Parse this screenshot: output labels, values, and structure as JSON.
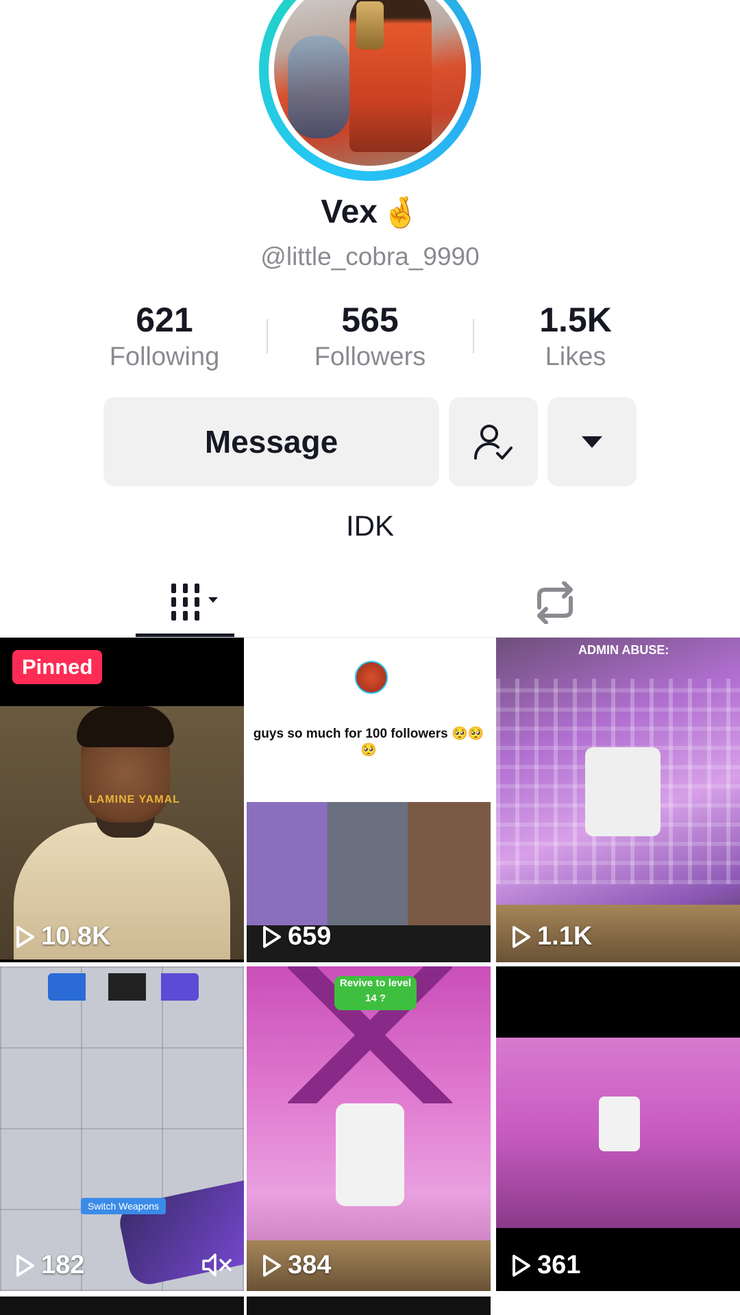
{
  "profile": {
    "display_name": "Vex",
    "name_emoji": "🤞",
    "handle": "@little_cobra_9990",
    "bio": "IDK"
  },
  "stats": {
    "following": {
      "value": "621",
      "label": "Following"
    },
    "followers": {
      "value": "565",
      "label": "Followers"
    },
    "likes": {
      "value": "1.5K",
      "label": "Likes"
    }
  },
  "actions": {
    "message_label": "Message",
    "friend_icon": "user-check-icon",
    "more_icon": "caret-down-icon"
  },
  "tabs": {
    "videos_icon": "grid-icon",
    "reposts_icon": "repost-icon"
  },
  "videos": [
    {
      "views": "10.8K",
      "pinned_label": "Pinned",
      "overlay_text": "LAMINE YAMAL"
    },
    {
      "views": "659",
      "caption": "guys so much for 100 followers 🥺🥺🥺"
    },
    {
      "views": "1.1K",
      "overlay_text": "ADMIN ABUSE:"
    },
    {
      "views": "182",
      "overlay_text": "Switch Weapons"
    },
    {
      "views": "384",
      "overlay_text": "Revive to level 14 ?"
    },
    {
      "views": "361"
    }
  ],
  "colors": {
    "accent": "#fe2c55",
    "avatar_ring": "#26c6f5",
    "button_bg": "#f1f1f2",
    "secondary_text": "#8a8b91"
  }
}
